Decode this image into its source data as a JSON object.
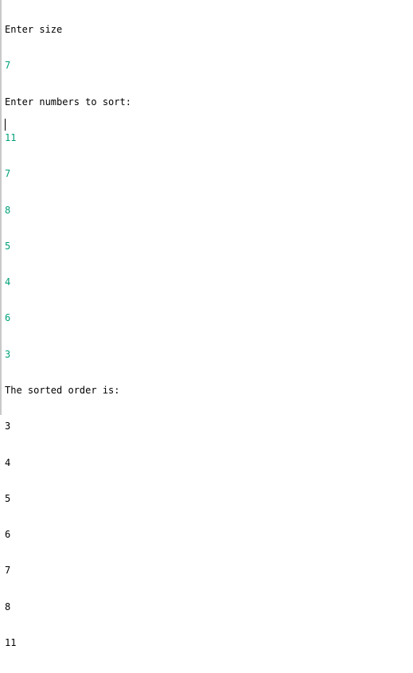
{
  "colors": {
    "output_text": "#000000",
    "user_input_text": "#00a078",
    "background": "#ffffff"
  },
  "console": {
    "prompt_size": "Enter size",
    "input_size": "7",
    "prompt_numbers": "Enter numbers to sort:",
    "input_numbers": [
      "11",
      "7",
      "8",
      "5",
      "4",
      "6",
      "3"
    ],
    "result_heading": "The sorted order is:",
    "sorted_numbers": [
      "3",
      "4",
      "5",
      "6",
      "7",
      "8",
      "11"
    ]
  }
}
